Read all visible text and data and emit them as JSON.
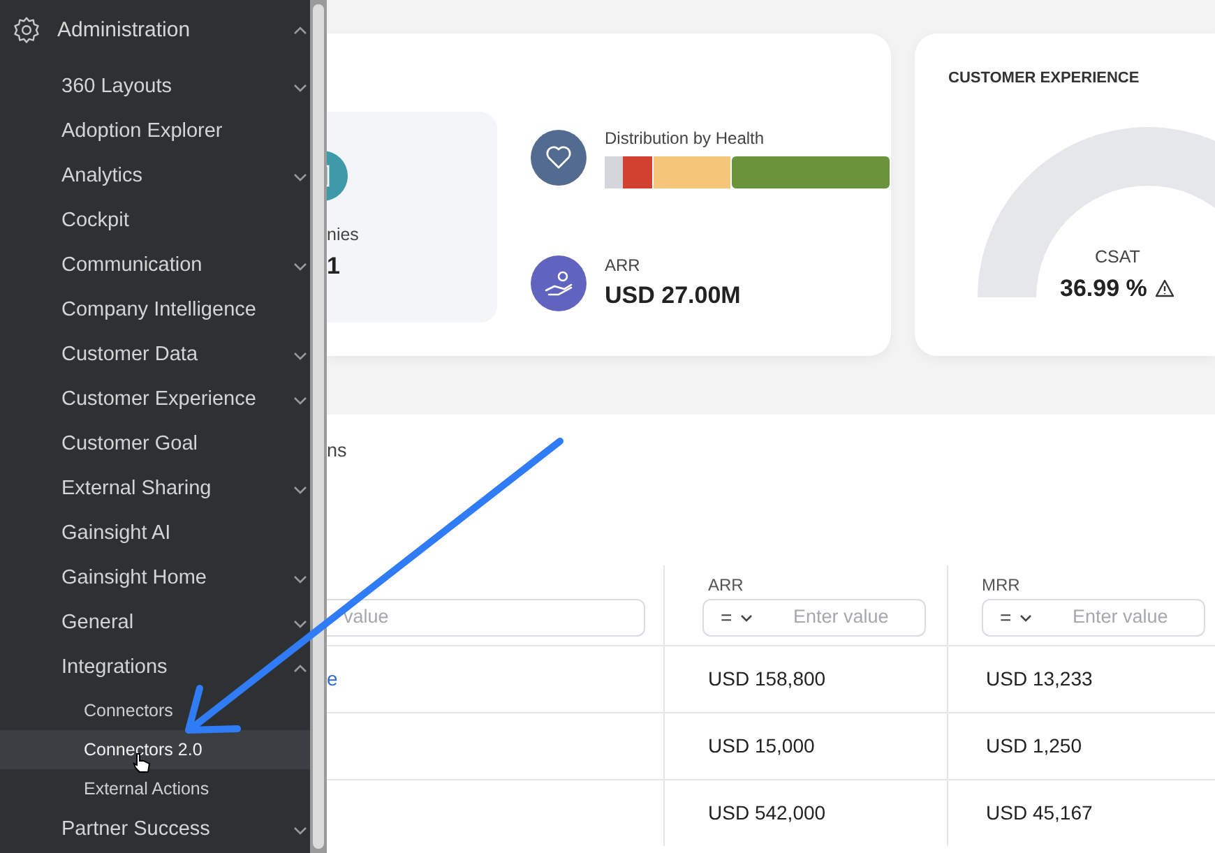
{
  "sidebar": {
    "section": {
      "label": "Administration",
      "expanded": true
    },
    "items": [
      {
        "label": "360 Layouts",
        "kind": "group",
        "expanded": false
      },
      {
        "label": "Adoption Explorer",
        "kind": "link"
      },
      {
        "label": "Analytics",
        "kind": "group",
        "expanded": false
      },
      {
        "label": "Cockpit",
        "kind": "link"
      },
      {
        "label": "Communication",
        "kind": "group",
        "expanded": false
      },
      {
        "label": "Company Intelligence",
        "kind": "link"
      },
      {
        "label": "Customer Data",
        "kind": "group",
        "expanded": false
      },
      {
        "label": "Customer Experience",
        "kind": "group",
        "expanded": false
      },
      {
        "label": "Customer Goal",
        "kind": "link"
      },
      {
        "label": "External Sharing",
        "kind": "group",
        "expanded": false
      },
      {
        "label": "Gainsight AI",
        "kind": "link"
      },
      {
        "label": "Gainsight Home",
        "kind": "group",
        "expanded": false
      },
      {
        "label": "General",
        "kind": "group",
        "expanded": false
      },
      {
        "label": "Integrations",
        "kind": "group",
        "expanded": true,
        "children": [
          {
            "label": "Connectors",
            "selected": false
          },
          {
            "label": "Connectors 2.0",
            "selected": true
          },
          {
            "label": "External Actions",
            "selected": false
          }
        ]
      },
      {
        "label": "Partner Success",
        "kind": "group",
        "expanded": false
      }
    ]
  },
  "summary": {
    "tile": {
      "label": "nies",
      "value": "1"
    },
    "health": {
      "label": "Distribution by Health"
    },
    "arr": {
      "label": "ARR",
      "value": "USD 27.00M"
    }
  },
  "customer_experience": {
    "title": "CUSTOMER EXPERIENCE",
    "gauge_label": "CSAT",
    "gauge_value": "36.99 %"
  },
  "table": {
    "title": "ns",
    "columns": [
      {
        "filter": {
          "placeholder": "value"
        }
      },
      {
        "header": "ARR",
        "filter": {
          "operator": "=",
          "placeholder": "Enter value"
        }
      },
      {
        "header": "MRR",
        "filter": {
          "operator": "=",
          "placeholder": "Enter value"
        }
      }
    ],
    "rows": [
      {
        "column_1": "e",
        "arr": "USD 158,800",
        "mrr": "USD 13,233"
      },
      {
        "arr": "USD 15,000",
        "mrr": "USD 1,250"
      },
      {
        "arr": "USD 542,000",
        "mrr": "USD 45,167"
      }
    ]
  }
}
